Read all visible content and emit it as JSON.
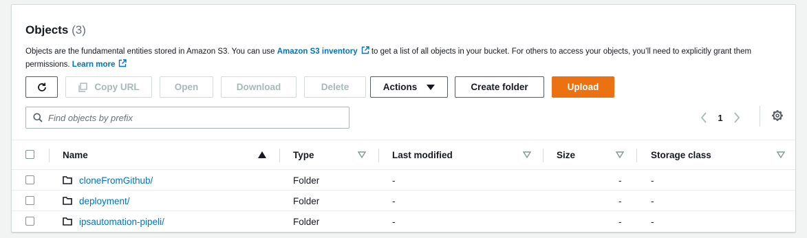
{
  "header": {
    "title": "Objects",
    "count": "(3)"
  },
  "description": {
    "text1": "Objects are the fundamental entities stored in Amazon S3. You can use ",
    "link1": "Amazon S3 inventory",
    "text2": " to get a list of all objects in your bucket. For others to access your objects, you’ll need to explicitly grant them permissions. ",
    "link2": "Learn more"
  },
  "toolbar": {
    "refresh_icon": "refresh-icon",
    "copy_url": "Copy URL",
    "open": "Open",
    "download": "Download",
    "delete": "Delete",
    "actions": "Actions",
    "create_folder": "Create folder",
    "upload": "Upload"
  },
  "search": {
    "placeholder": "Find objects by prefix",
    "value": ""
  },
  "pagination": {
    "page": "1"
  },
  "colors": {
    "primary": "#ec7211",
    "link": "#0073bb",
    "disabled": "#aab7b8"
  },
  "table": {
    "columns": [
      "Name",
      "Type",
      "Last modified",
      "Size",
      "Storage class"
    ],
    "rows": [
      {
        "name": "cloneFromGithub/",
        "type": "Folder",
        "last_modified": "-",
        "size": "-",
        "storage_class": "-"
      },
      {
        "name": "deployment/",
        "type": "Folder",
        "last_modified": "-",
        "size": "-",
        "storage_class": "-"
      },
      {
        "name": "ipsautomation-pipeli/",
        "type": "Folder",
        "last_modified": "-",
        "size": "-",
        "storage_class": "-"
      }
    ]
  }
}
